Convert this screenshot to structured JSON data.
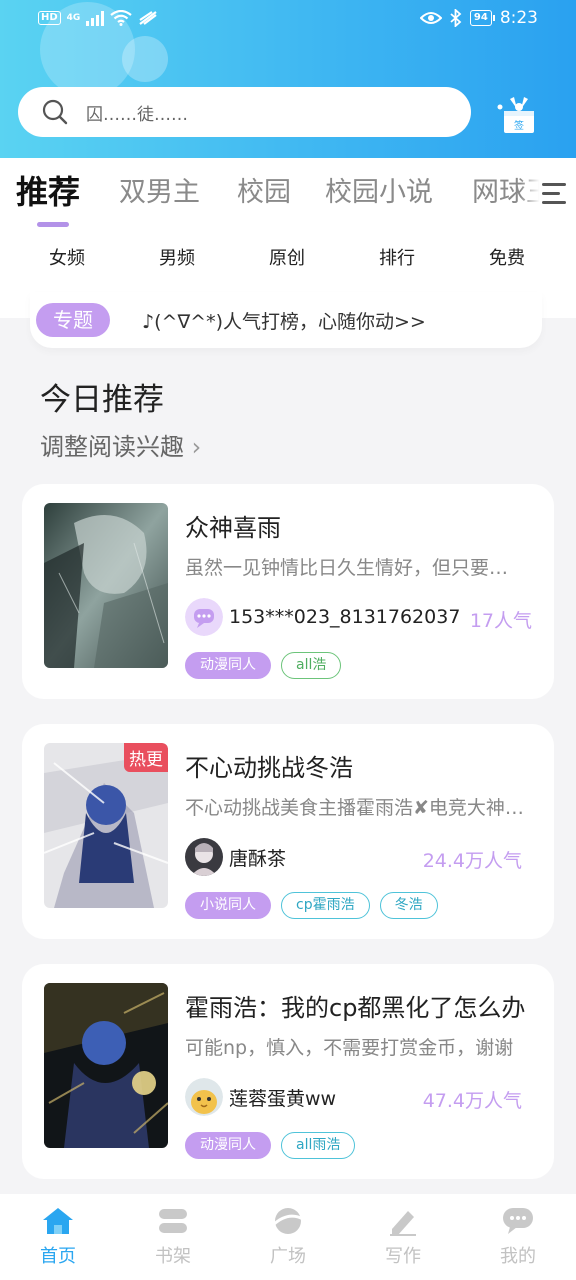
{
  "status_bar": {
    "hd": "HD",
    "signal": "4G",
    "battery": "94",
    "time": "8:23"
  },
  "search": {
    "placeholder": "囚……徒……"
  },
  "sign_in": {
    "label": "签"
  },
  "tabs": [
    "推荐",
    "双男主",
    "校园",
    "校园小说",
    "网球王"
  ],
  "subnav": [
    "女频",
    "男频",
    "原创",
    "排行",
    "免费"
  ],
  "topic": {
    "badge": "专题",
    "text": "♪(^∇^*)人气打榜，心随你动>>"
  },
  "section": {
    "title": "今日推荐",
    "subtitle": "调整阅读兴趣",
    "subtitle_arrow": "›"
  },
  "books": [
    {
      "title": "众神喜雨",
      "desc": "虽然一见钟情比日久生情好，但只要能在一起就好了",
      "author": "153***023_8131762037",
      "popularity": "17人气",
      "tags": [
        "动漫同人",
        "all浩"
      ],
      "hot": ""
    },
    {
      "title": "不心动挑战冬浩",
      "desc": "不心动挑战美食主播霍雨浩✘电竞大神王冬",
      "author": "唐酥茶",
      "popularity": "24.4万人气",
      "tags": [
        "小说同人",
        "cp霍雨浩",
        "冬浩"
      ],
      "hot": "热更"
    },
    {
      "title": "霍雨浩：我的cp都黑化了怎么办",
      "desc": "可能np，慎入，不需要打赏金币，谢谢",
      "author": "莲蓉蛋黄ww",
      "popularity": "47.4万人气",
      "tags": [
        "动漫同人",
        "all雨浩"
      ],
      "hot": ""
    }
  ],
  "bottom_nav": [
    "首页",
    "书架",
    "广场",
    "写作",
    "我的"
  ],
  "colors": {
    "accent_purple": "#c49df0",
    "accent_blue": "#2aa6f0",
    "header_gradient": [
      "#5ad3f2",
      "#2aa1f0"
    ],
    "hot_red": "#e94f5e"
  }
}
